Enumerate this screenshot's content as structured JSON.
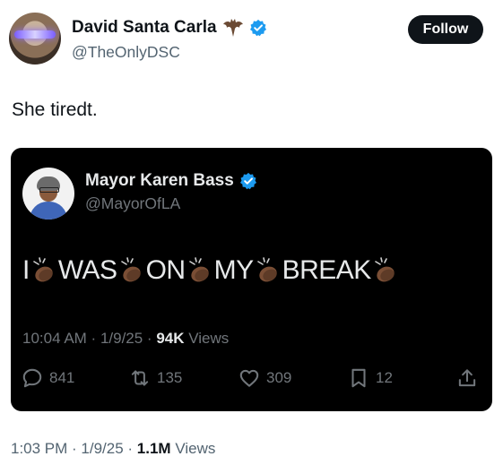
{
  "author": {
    "display_name": "David Santa Carla",
    "handle": "@TheOnlyDSC",
    "emoji_icon": "bat-icon",
    "verified_icon": "verified-badge-icon"
  },
  "follow_button": {
    "label": "Follow"
  },
  "tweet": {
    "text": "She tiredt."
  },
  "quoted_tweet": {
    "display_name": "Mayor Karen Bass",
    "handle": "@MayorOfLA",
    "words": [
      "I",
      "WAS",
      "ON",
      "MY",
      "BREAK"
    ],
    "clap_icon": "clapping-hands-icon",
    "time": "10:04 AM",
    "date": "1/9/25",
    "views_count": "94K",
    "views_label": "Views",
    "replies": "841",
    "reposts": "135",
    "likes": "309",
    "bookmarks": "12"
  },
  "footer": {
    "time": "1:03 PM",
    "date": "1/9/25",
    "views_count": "1.1M",
    "views_label": "Views"
  },
  "colors": {
    "text_primary": "#0f1419",
    "text_secondary": "#536471",
    "verified_blue": "#1d9bf0",
    "card_bg": "#000000"
  }
}
